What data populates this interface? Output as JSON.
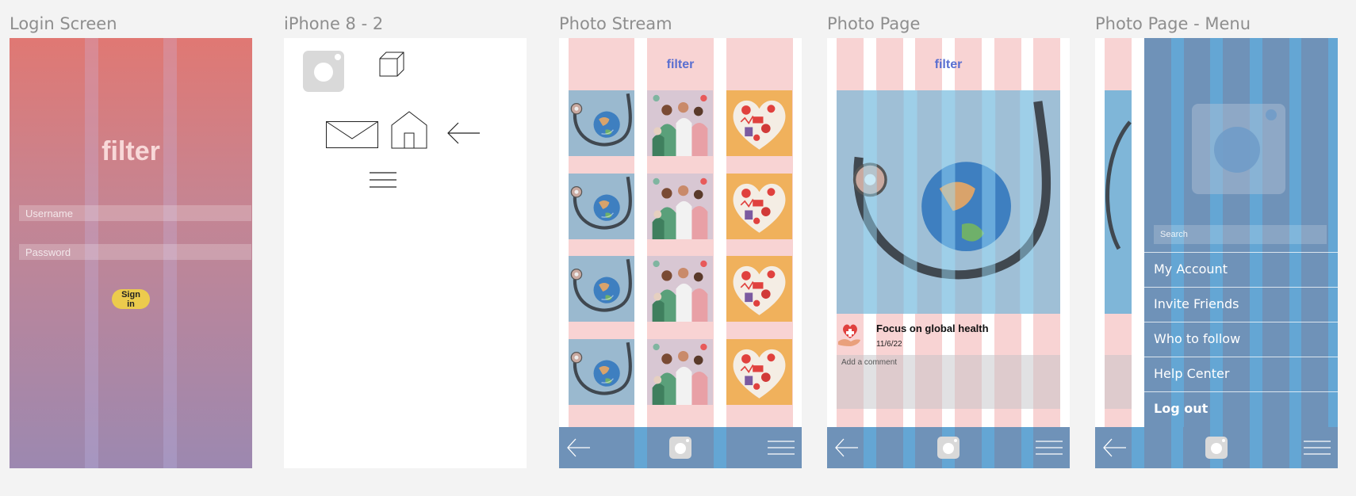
{
  "frames": {
    "login": "Login Screen",
    "iphone": "iPhone 8 - 2",
    "stream": "Photo Stream",
    "page": "Photo Page",
    "menu": "Photo Page - Menu"
  },
  "login": {
    "logo": "filter",
    "username_placeholder": "Username",
    "password_placeholder": "Password",
    "signin_label": "Sign in"
  },
  "iphone": {
    "icons": [
      "camera-icon",
      "cube-icon",
      "envelope-icon",
      "home-icon",
      "back-arrow-icon",
      "hamburger-menu-icon"
    ]
  },
  "stream": {
    "logo": "filter",
    "rows": 4,
    "columns": [
      "globe-stethoscope-photo",
      "medical-staff-illustration",
      "heart-health-illustration"
    ]
  },
  "page": {
    "logo": "filter",
    "post_title": "Focus on global health",
    "post_date": "11/6/22",
    "comment_placeholder": "Add a comment"
  },
  "menu": {
    "search_placeholder": "Search",
    "items": [
      "My Account",
      "Invite Friends",
      "Who to follow",
      "Help Center",
      "Log out"
    ]
  },
  "colors": {
    "background": "#f3f3f3",
    "pink_grid": "#f8d3d3",
    "bar_blue": "#6f92b8",
    "bar_light_blue": "#64a6d4",
    "filter_blue": "#5a6fd0",
    "signin_yellow": "#eccb4d",
    "login_gradient_top": "#e07873",
    "login_gradient_bottom": "#9c88b0"
  },
  "bottom_bar_icons": [
    "back-arrow-icon",
    "camera-icon",
    "hamburger-menu-icon"
  ]
}
